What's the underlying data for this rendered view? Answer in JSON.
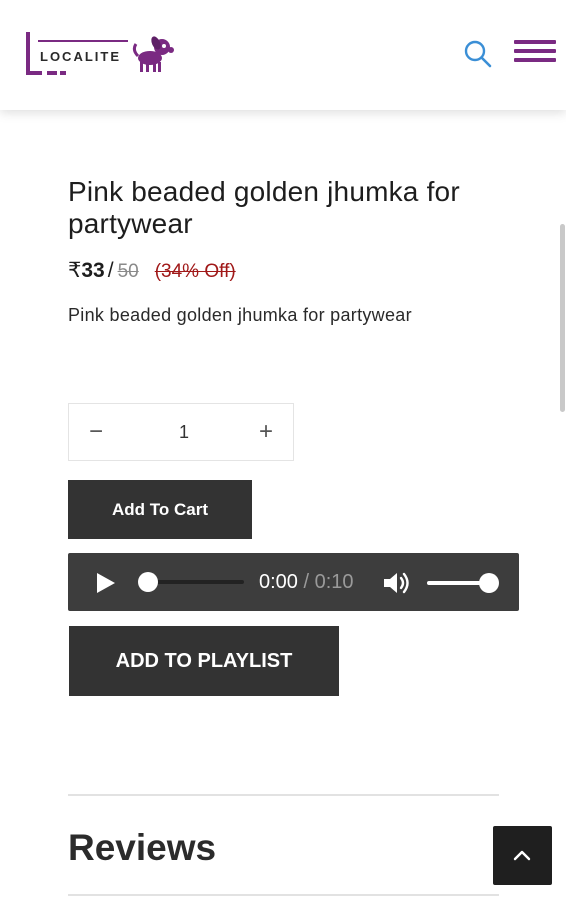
{
  "header": {
    "logo_text": "LOCALITE",
    "icons": {
      "search": "search-icon",
      "menu": "hamburger-menu-icon"
    },
    "colors": {
      "brand": "#7a2a82",
      "search": "#3b8fd6"
    }
  },
  "product": {
    "title": "Pink beaded golden jhumka for partywear",
    "currency": "₹",
    "price": "33",
    "separator": "/",
    "original_price": "50",
    "discount": "(34% Off)",
    "description": "Pink beaded golden jhumka for partywear"
  },
  "quantity": {
    "minus": "−",
    "value": "1",
    "plus": "+"
  },
  "actions": {
    "add_to_cart": "Add To Cart",
    "add_to_playlist": "ADD TO PLAYLIST"
  },
  "audio": {
    "current_time": "0:00",
    "time_separator": "/",
    "duration": "0:10",
    "progress": 0,
    "volume": 1,
    "icons": {
      "play": "play-icon",
      "volume": "volume-icon"
    }
  },
  "reviews": {
    "title": "Reviews"
  },
  "scroll_top": {
    "icon": "chevron-up-icon"
  },
  "colors": {
    "button_bg": "#333333",
    "audio_bg": "#3d3d3d",
    "discount": "#a01818"
  }
}
